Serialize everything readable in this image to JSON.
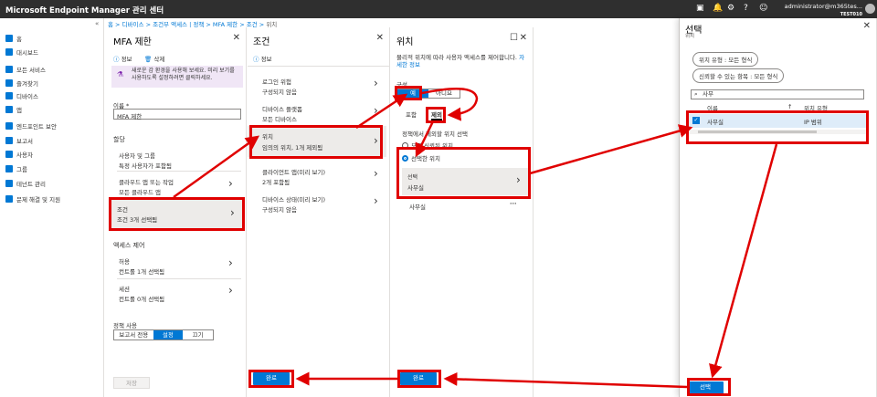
{
  "topbar": {
    "title": "Microsoft Endpoint Manager 관리 센터",
    "user": "administrator@m365tes...",
    "tenant": "TEST010"
  },
  "nav": {
    "items": [
      {
        "label": "홈",
        "icon": "home-icon"
      },
      {
        "label": "대시보드",
        "icon": "dashboard-icon"
      },
      {
        "label": "모든 서비스",
        "icon": "list-icon"
      },
      {
        "label": "즐겨찾기",
        "icon": "star-icon"
      },
      {
        "label": "디바이스",
        "icon": "device-icon"
      },
      {
        "label": "앱",
        "icon": "apps-icon"
      },
      {
        "label": "엔드포인트 보안",
        "icon": "shield-icon"
      },
      {
        "label": "보고서",
        "icon": "report-icon"
      },
      {
        "label": "사용자",
        "icon": "user-icon"
      },
      {
        "label": "그룹",
        "icon": "group-icon"
      },
      {
        "label": "테넌트 관리",
        "icon": "tenant-icon"
      },
      {
        "label": "문제 해결 및 지원",
        "icon": "wrench-icon"
      }
    ]
  },
  "breadcrumb": {
    "home": "홈",
    "items": [
      "디바이스",
      "조건부 액세스 | 정책",
      "MFA 제한",
      "조건",
      "위치"
    ]
  },
  "mfa": {
    "title": "MFA 제한",
    "info": "정보",
    "delete": "삭제",
    "banner": "새로운 감 환경을 사용해 보세요. 미리 보기를 사용하도록 설정하려면 클릭하세요.",
    "name_label": "이름 *",
    "name_value": "MFA 제한",
    "assign_label": "할당",
    "users_label": "사용자 및 그룹",
    "users_value": "특정 사용자가 포함됨",
    "apps_label": "클라우드 앱 또는 작업",
    "apps_value": "모든 클라우드 앱",
    "cond_label": "조건",
    "cond_value": "조건 3개 선택됨",
    "access_label": "액세스 제어",
    "grant_label": "허용",
    "grant_value": "컨트롤 1개 선택됨",
    "session_label": "세션",
    "session_value": "컨트롤 0개 선택됨",
    "enable_label": "정책 사용",
    "toggle": [
      "보고서 전용",
      "설정",
      "끄기"
    ],
    "save": "저장"
  },
  "cond": {
    "title": "조건",
    "info": "정보",
    "items": [
      {
        "label": "로그인 위험",
        "value": "구성되지 않음"
      },
      {
        "label": "디바이스 플랫폼",
        "value": "모든 디바이스"
      },
      {
        "label": "위치",
        "value": "임의의 위치, 1개 제외됨"
      },
      {
        "label": "클라이언트 앱(미리 보기)",
        "value": "2개 포함됨"
      },
      {
        "label": "디바이스 상태(미리 보기)",
        "value": "구성되지 않음"
      }
    ],
    "done": "완료"
  },
  "loc": {
    "title": "위치",
    "desc": "물리적 위치에 따라 사용자 액세스를 제어합니다.",
    "more": "자세한 정보",
    "config": "구성",
    "yes": "예",
    "no": "아니요",
    "tab_include": "포함",
    "tab_exclude": "제외",
    "select_label": "정책에서 제외할 위치 선택",
    "opt_all": "모든 신뢰된 위치",
    "opt_selected": "선택한 위치",
    "sel_label": "선택",
    "sel_value": "사무실",
    "row": "사무실",
    "done": "완료"
  },
  "select": {
    "title": "선택",
    "subtitle": "위치",
    "filter1": "위치 유형 : 모든 형식",
    "filter2": "신뢰할 수 있는 항목 : 모든 형식",
    "search": "사무",
    "col_name": "이름",
    "col_type": "위치 유형",
    "row_name": "사무실",
    "row_type": "IP 범위",
    "select_btn": "선택"
  }
}
